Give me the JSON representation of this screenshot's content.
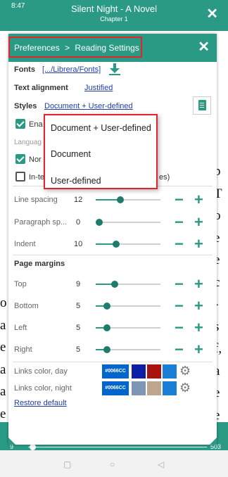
{
  "status": {
    "time": "8:47"
  },
  "app": {
    "title": "Silent Night - A Novel",
    "subtitle": "Chapter 1"
  },
  "dialog": {
    "breadcrumb": {
      "root": "Preferences",
      "sep": ">",
      "current": "Reading Settings"
    },
    "fonts": {
      "label": "Fonts",
      "path": "[.../Librera/Fonts]"
    },
    "alignment": {
      "label": "Text alignment",
      "value": "Justified"
    },
    "styles": {
      "label": "Styles",
      "value": "Document + User-defined"
    },
    "enable": {
      "text": "Ena",
      "checked": true
    },
    "language": {
      "text": "Languag"
    },
    "normal": {
      "text": "Nor",
      "checked": true
    },
    "intext": {
      "text": "In-te",
      "suffix": "es)",
      "checked": false
    },
    "line_spacing": {
      "label": "Line spacing",
      "value": "12",
      "level": 0.38
    },
    "paragraph_spacing": {
      "label": "Paragraph sp...",
      "value": "0",
      "level": 0.0
    },
    "indent": {
      "label": "Indent",
      "value": "10",
      "level": 0.32
    },
    "margins": {
      "title": "Page margins",
      "items": [
        {
          "label": "Top",
          "value": "9",
          "level": 0.29
        },
        {
          "label": "Bottom",
          "value": "5",
          "level": 0.17
        },
        {
          "label": "Left",
          "value": "5",
          "level": 0.17
        },
        {
          "label": "Right",
          "value": "5",
          "level": 0.17
        }
      ]
    },
    "links_day": {
      "label": "Links color, day",
      "hex": "#0066CC",
      "colors": [
        "#0a1fa3",
        "#a8120f",
        "#1a7ed6"
      ]
    },
    "links_night": {
      "label": "Links color, night",
      "hex": "#0066CC",
      "colors": [
        "#7d96b6",
        "#bda58e",
        "#1a7ed6"
      ]
    },
    "restore": "Restore default",
    "minus": "−",
    "plus": "+"
  },
  "dropdown": {
    "options": [
      "Document + User-defined",
      "Document",
      "User-defined"
    ]
  },
  "bottom": {
    "page_left": "9",
    "page_right": "503"
  },
  "bg_text": {
    "right": [
      "p",
      "T",
      "o",
      "e",
      "e",
      "c",
      "-",
      "s",
      "f,",
      "a",
      "e",
      "e",
      "k",
      "a"
    ],
    "left": [
      "o",
      "a",
      "e",
      "a",
      "a",
      "e"
    ]
  },
  "colors": {
    "accent": "#2a9a85",
    "highlight": "#e2242d",
    "link": "#1f3ea8"
  }
}
